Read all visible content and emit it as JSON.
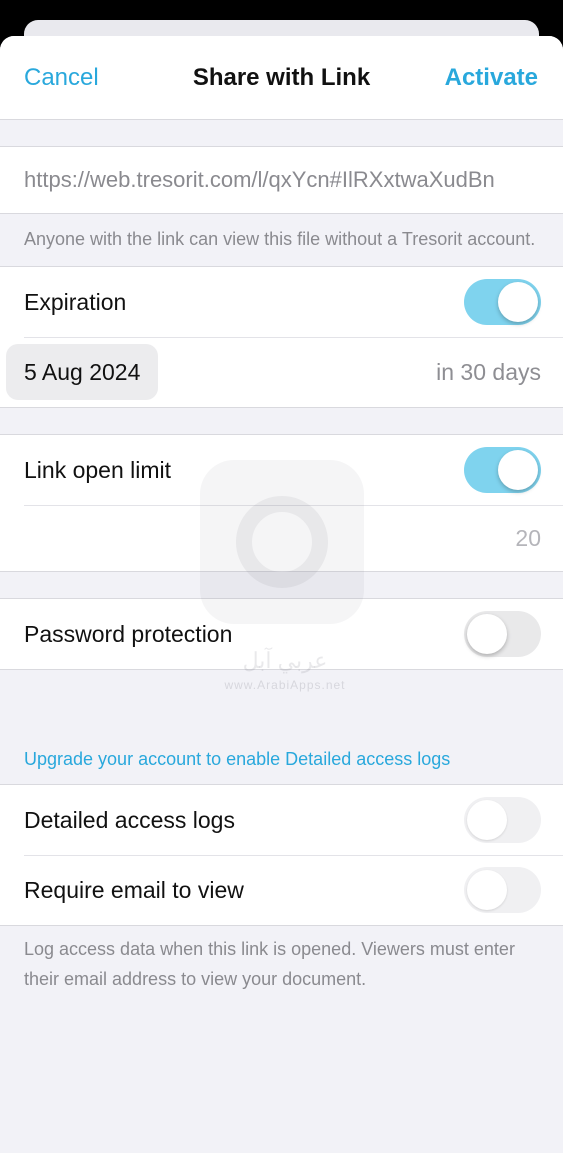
{
  "nav": {
    "cancel": "Cancel",
    "title": "Share with Link",
    "activate": "Activate"
  },
  "link": {
    "url": "https://web.tresorit.com/l/qxYcn#IlRXxtwaXudBn",
    "note": "Anyone with the link can view this file without a Tresorit account."
  },
  "expiration": {
    "label": "Expiration",
    "enabled": true,
    "date": "5 Aug 2024",
    "relative": "in 30 days"
  },
  "open_limit": {
    "label": "Link open limit",
    "enabled": true,
    "value": "20"
  },
  "password": {
    "label": "Password protection",
    "enabled": false
  },
  "upgrade_link": "Upgrade your account to enable Detailed access logs",
  "access": {
    "detailed_logs_label": "Detailed access logs",
    "detailed_logs_enabled": false,
    "require_email_label": "Require email to view",
    "require_email_enabled": false,
    "note": "Log access data when this link is opened. Viewers must enter their email address to view your document."
  },
  "watermark": {
    "arabic": "عربي آبل",
    "url": "www.ArabiApps.net"
  },
  "colors": {
    "accent": "#29a8dc",
    "toggle_on": "#7fd3ee"
  }
}
